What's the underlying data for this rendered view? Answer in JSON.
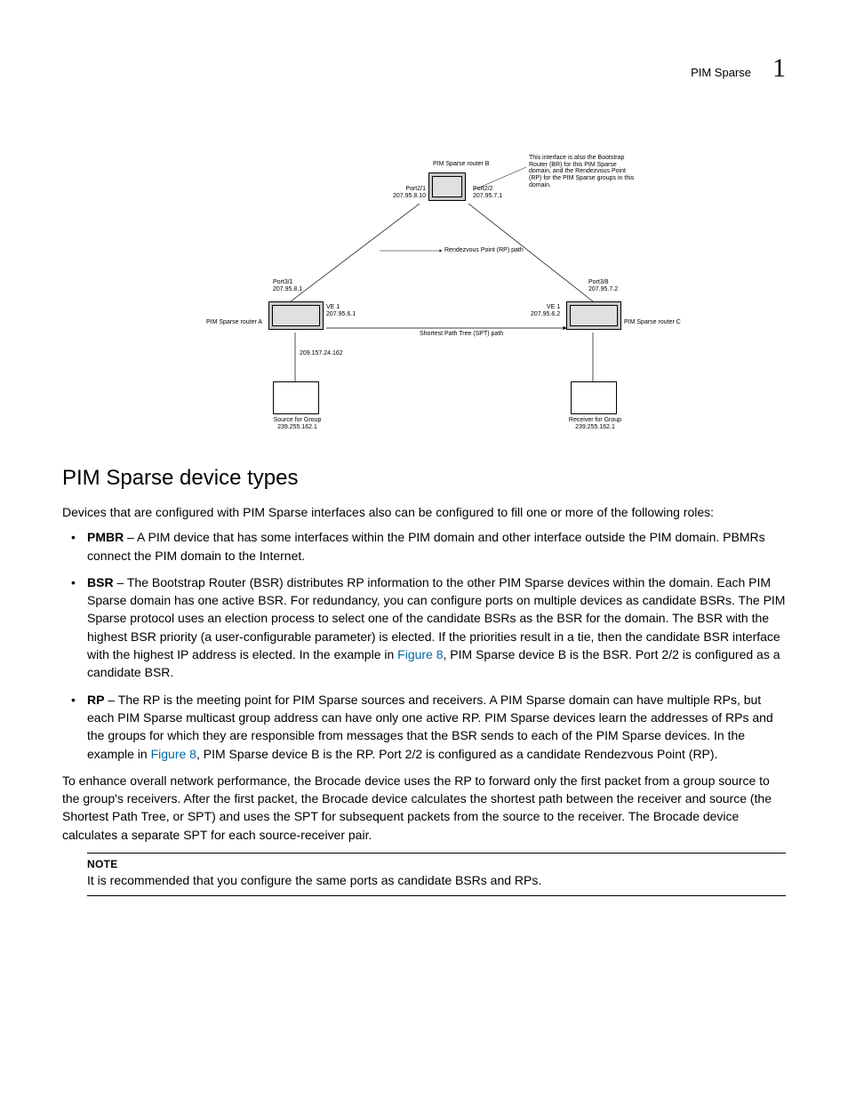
{
  "header": {
    "section": "PIM Sparse",
    "chapter": "1"
  },
  "diagram": {
    "caption_top": "This interface is also the Bootstrap Router (BR) for this PIM Sparse domain, and the Rendezvous Point (RP) for the PIM Sparse groups in this domain.",
    "router_b": "PIM Sparse router B",
    "port21": "Port2/1\n207.95.8.10",
    "port22": "Port2/2\n207.95.7.1",
    "rp_path": "Rendezvous Point (RP) path",
    "port31": "Port3/1\n207.95.8.1",
    "port38": "Port3/8\n207.95.7.2",
    "ve1_left": "VE 1\n207.95.6.1",
    "ve1_right": "VE 1\n207.95.6.2",
    "spt_path": "Shortest Path Tree (SPT) path",
    "router_a": "PIM Sparse router A",
    "router_c": "PIM Sparse router C",
    "src_ip": "209.157.24.162",
    "source": "Source for Group\n239.255.162.1",
    "receiver": "Receiver for Group\n239.255.162.1"
  },
  "section_title": "PIM Sparse device types",
  "intro": "Devices that are configured with PIM Sparse interfaces also can be configured to fill one or more of the following roles:",
  "bullets": {
    "pmbr_term": "PMBR",
    "pmbr_text": " – A PIM device that has some interfaces within the PIM domain and other interface outside the PIM domain. PBMRs connect the PIM domain to the Internet.",
    "bsr_term": "BSR",
    "bsr_text1": " – The Bootstrap Router (BSR) distributes RP information to the other PIM Sparse devices within the domain. Each PIM Sparse domain has one active BSR. For redundancy, you can configure ports on multiple devices as candidate BSRs. The PIM Sparse protocol uses an election process to select one of the candidate BSRs as the BSR for the domain. The BSR with the highest BSR priority (a user-configurable parameter) is elected. If the priorities result in a tie, then the candidate BSR interface with the highest IP address is elected. In the example in ",
    "bsr_link": "Figure 8",
    "bsr_text2": ", PIM Sparse device B is the BSR. Port 2/2 is configured as a candidate BSR.",
    "rp_term": "RP",
    "rp_text1": " – The RP is the meeting point for PIM Sparse sources and receivers. A PIM Sparse domain can have multiple RPs, but each PIM Sparse multicast group address can have only one active RP. PIM Sparse devices learn the addresses of RPs and the groups for which they are responsible from messages that the BSR sends to each of the PIM Sparse devices. In the example in ",
    "rp_link": "Figure 8",
    "rp_text2": ", PIM Sparse device B is the RP. Port 2/2 is configured as a candidate Rendezvous Point (RP)."
  },
  "perf": "To enhance overall network performance, the Brocade device uses the RP to forward only the first packet from a group source to the group's receivers. After the first packet, the Brocade device calculates the shortest path between the receiver and source (the Shortest Path Tree, or SPT) and uses the SPT for subsequent packets from the source to the receiver. The Brocade device calculates a separate SPT for each source-receiver pair.",
  "note": {
    "title": "NOTE",
    "text": "It is recommended that you configure the same ports as candidate BSRs and RPs."
  }
}
